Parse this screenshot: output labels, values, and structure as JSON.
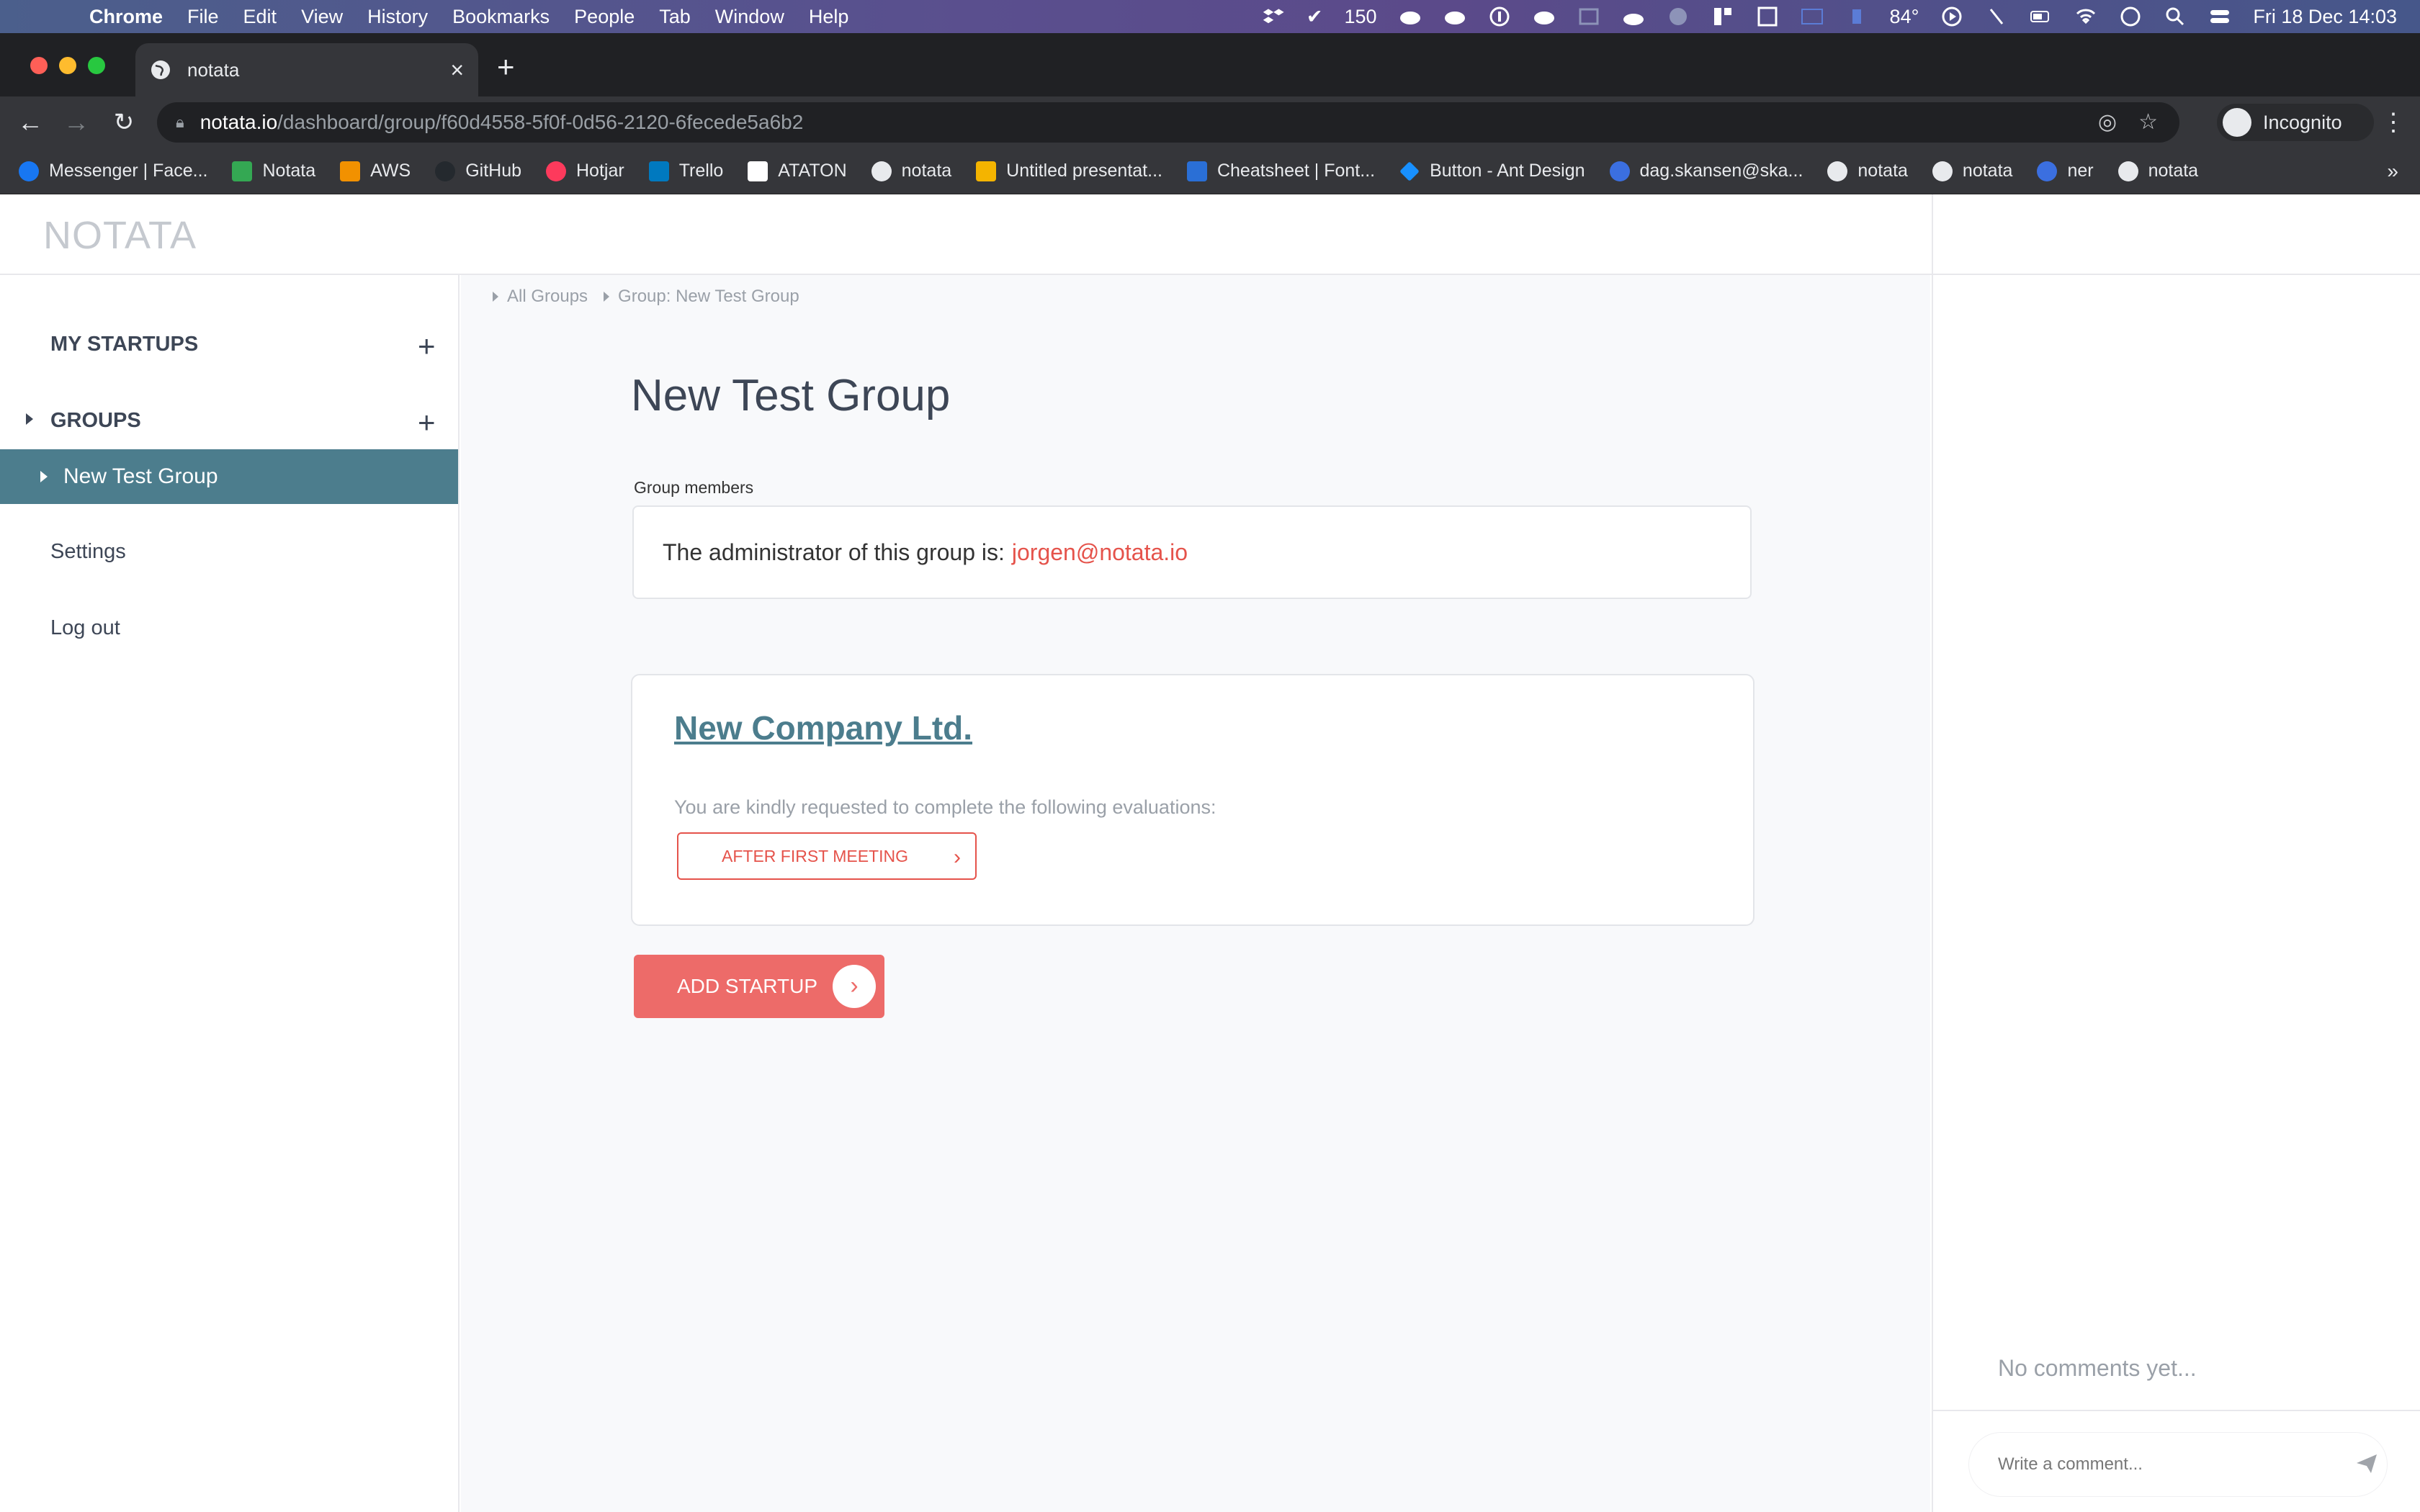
{
  "menubar": {
    "app": "Chrome",
    "items": [
      "File",
      "Edit",
      "View",
      "History",
      "Bookmarks",
      "People",
      "Tab",
      "Window",
      "Help"
    ],
    "status_count": "150",
    "temperature": "84°",
    "datetime": "Fri 18 Dec  14:03"
  },
  "browser": {
    "tab_title": "notata",
    "url_host": "notata.io",
    "url_path": "/dashboard/group/f60d4558-5f0f-0d56-2120-6fecede5a6b2",
    "profile_label": "Incognito"
  },
  "bookmarks": [
    {
      "label": "Messenger | Face...",
      "color": "#1877f2"
    },
    {
      "label": "Notata",
      "color": "#34a853"
    },
    {
      "label": "AWS",
      "color": "#f29100"
    },
    {
      "label": "GitHub",
      "color": "#24292e"
    },
    {
      "label": "Hotjar",
      "color": "#fd3a5c"
    },
    {
      "label": "Trello",
      "color": "#0079bf"
    },
    {
      "label": "ATATON",
      "color": "#ffffff"
    },
    {
      "label": "notata",
      "color": "#9aa0a6"
    },
    {
      "label": "Untitled presentat...",
      "color": "#f4b400"
    },
    {
      "label": "Cheatsheet | Font...",
      "color": "#2a6fd6"
    },
    {
      "label": "Button - Ant Design",
      "color": "#1890ff"
    },
    {
      "label": "dag.skansen@ska...",
      "color": "#3b6fe0"
    },
    {
      "label": "notata",
      "color": "#9aa0a6"
    },
    {
      "label": "notata",
      "color": "#9aa0a6"
    },
    {
      "label": "ner",
      "color": "#3b6fe0"
    },
    {
      "label": "notata",
      "color": "#9aa0a6"
    }
  ],
  "app": {
    "logo": "NOTATA",
    "sidebar": {
      "my_startups": "MY STARTUPS",
      "groups": "GROUPS",
      "active_group": "New Test Group",
      "settings": "Settings",
      "logout": "Log out"
    },
    "breadcrumb": [
      "All Groups",
      "Group: New Test Group"
    ],
    "title": "New Test Group",
    "members_label": "Group members",
    "admin_text": "The administrator of this group is:",
    "admin_email": "jorgen@notata.io",
    "company": {
      "name": "New Company Ltd.",
      "eval_text": "You are kindly requested to complete the following evaluations:",
      "eval_button": "AFTER FIRST MEETING"
    },
    "add_startup": "ADD STARTUP",
    "comments": {
      "empty": "No comments yet...",
      "placeholder": "Write a comment..."
    }
  },
  "colors": {
    "accent_teal": "#4c7d8d",
    "accent_coral": "#ed6b69",
    "link_red": "#e5534b"
  }
}
